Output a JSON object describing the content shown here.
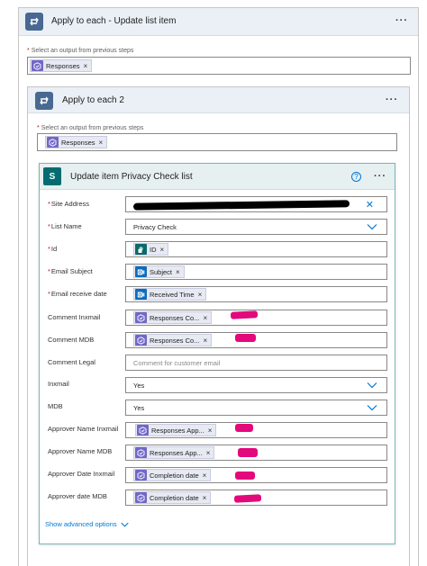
{
  "outer_loop": {
    "title": "Apply to each - Update list item",
    "more": "···",
    "select_label": "Select an output from previous steps",
    "required_mark": "*",
    "token": "Responses"
  },
  "inner_loop": {
    "title": "Apply to each 2",
    "more": "···",
    "select_label": "Select an output from previous steps",
    "required_mark": "*",
    "token": "Responses"
  },
  "action": {
    "title": "Update item Privacy Check list",
    "help": "?",
    "more": "···",
    "badge": "S",
    "fields": {
      "site_address": {
        "label": "Site Address",
        "required": "*",
        "clear": "✕"
      },
      "list_name": {
        "label": "List Name",
        "required": "*",
        "value": "Privacy Check"
      },
      "id": {
        "label": "Id",
        "required": "*",
        "token": "ID"
      },
      "email_subject": {
        "label": "Email Subject",
        "required": "*",
        "token": "Subject"
      },
      "email_receive_date": {
        "label": "Email receive date",
        "required": "*",
        "token": "Received Time"
      },
      "comment_inxmail": {
        "label": "Comment Inxmail",
        "token": "Responses Co..."
      },
      "comment_mdb": {
        "label": "Comment MDB",
        "token": "Responses Co..."
      },
      "comment_legal": {
        "label": "Comment Legal",
        "placeholder": "Comment for customer email"
      },
      "inxmail": {
        "label": "Inxmail",
        "value": "Yes"
      },
      "mdb": {
        "label": "MDB",
        "value": "Yes"
      },
      "approver_name_inxmail": {
        "label": "Approver Name Inxmail",
        "token": "Responses App..."
      },
      "approver_name_mdb": {
        "label": "Approver Name MDB",
        "token": "Responses App..."
      },
      "approver_date_inxmail": {
        "label": "Approver Date Inxmail",
        "token": "Completion date"
      },
      "approver_date_mdb": {
        "label": "Approver date MDB",
        "token": "Completion date"
      }
    },
    "advanced_options": "Show advanced options",
    "token_remove": "×"
  },
  "colors": {
    "loop_badge": "#486991",
    "sharepoint": "#036c70",
    "forms_token_icon": "#7167c7",
    "outlook_token_icon": "#0f6cbd",
    "link": "#0078d4",
    "highlight": "#e3097c"
  },
  "icons": {
    "loop": "loop-icon",
    "forms": "forms-icon",
    "outlook": "outlook-icon",
    "sharepoint": "sharepoint-icon",
    "chevron": "chevron-down-icon"
  }
}
